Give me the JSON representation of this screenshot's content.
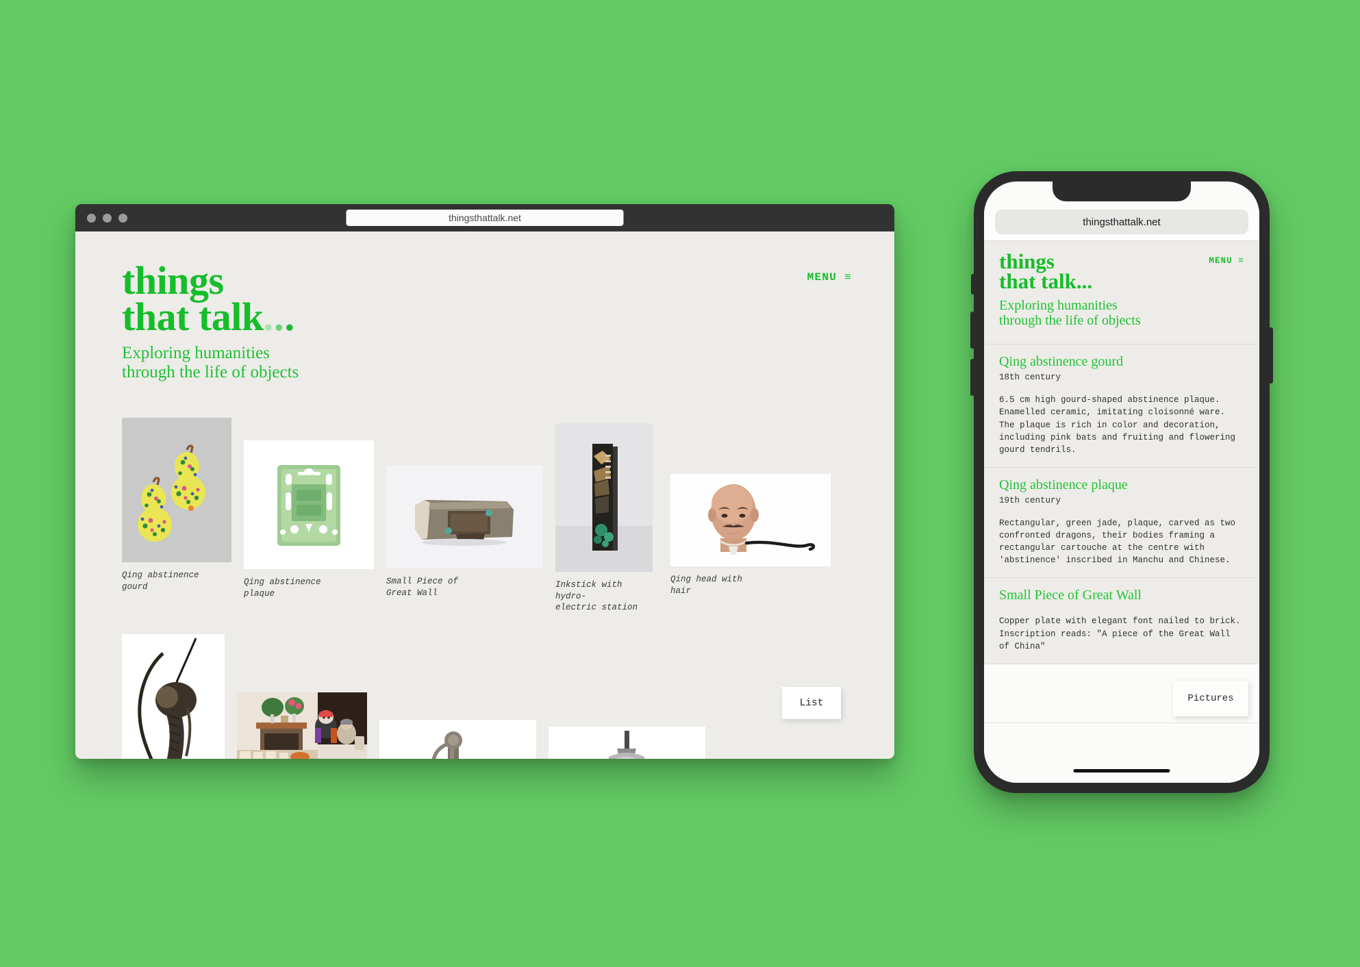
{
  "background_color": "#62ca63",
  "brand_color": "#16bd2b",
  "desktop": {
    "browser": {
      "url": "thingsthattalk.net",
      "traffic_lights": [
        "close-dot",
        "minimize-dot",
        "maximize-dot"
      ]
    },
    "header": {
      "logo_line1": "things",
      "logo_line2": "that talk",
      "logo_dots": "...",
      "tagline_line1": "Exploring humanities",
      "tagline_line2": "through the life of objects",
      "menu_label": "MENU",
      "menu_icon": "hamburger-icon"
    },
    "gallery": {
      "row1": [
        {
          "caption": "Qing abstinence gourd",
          "art": "gourd"
        },
        {
          "caption": "Qing abstinence plaque",
          "art": "jade"
        },
        {
          "caption": "Small Piece of Great Wall",
          "art": "brick"
        },
        {
          "caption": "Inkstick with hydro-electric station",
          "art": "inkstick"
        },
        {
          "caption": "Qing head with hair",
          "art": "head"
        }
      ],
      "row2": [
        {
          "caption": "",
          "art": "queue"
        },
        {
          "caption": "",
          "art": "interior"
        },
        {
          "caption": "",
          "art": "sword"
        },
        {
          "caption": "",
          "art": "helmet"
        }
      ]
    },
    "list_button_label": "List"
  },
  "phone": {
    "url": "thingsthattalk.net",
    "header": {
      "logo_line1": "things",
      "logo_line2": "that talk",
      "logo_dots": "...",
      "tagline_line1": "Exploring humanities",
      "tagline_line2": "through the life of objects",
      "menu_label": "MENU",
      "menu_icon": "hamburger-icon"
    },
    "entries": [
      {
        "title": "Qing abstinence gourd",
        "date": "18th century",
        "body": "6.5 cm high gourd-shaped abstinence plaque. Enamelled ceramic, imitating cloisonné ware. The plaque is rich in color and decoration, including pink bats and fruiting and flowering gourd tendrils."
      },
      {
        "title": "Qing abstinence plaque",
        "date": "19th century",
        "body": "Rectangular, green jade, plaque, carved as two confronted dragons, their bodies framing a rectangular cartouche at the centre with 'abstinence' inscribed in Manchu and Chinese."
      },
      {
        "title": "Small Piece of Great Wall",
        "date": "",
        "body": "Copper plate with elegant font nailed to brick. Inscription reads: \"A piece of the Great Wall of China\""
      }
    ],
    "pictures_button_label": "Pictures"
  }
}
